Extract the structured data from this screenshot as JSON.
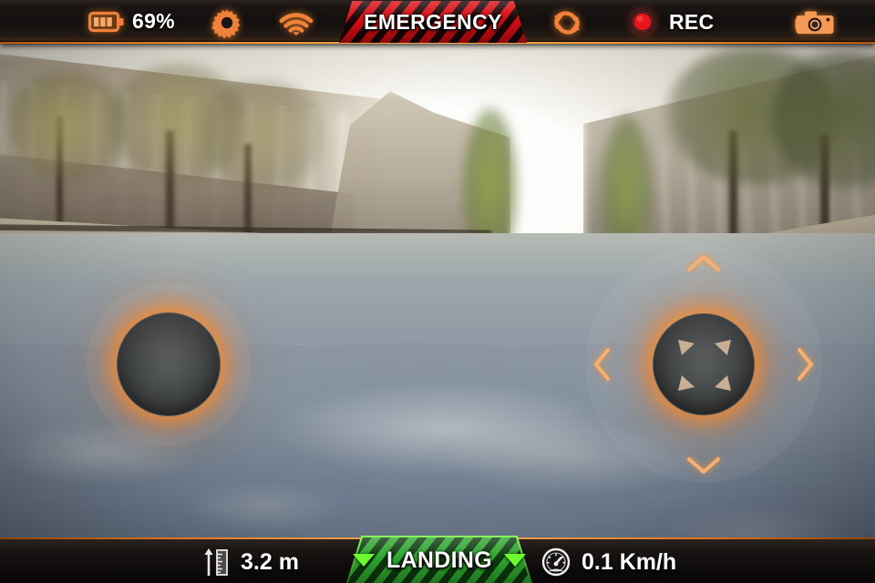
{
  "app": {
    "name": "drone-piloting-hud",
    "accent_color": "#e3741a",
    "emergency_color": "#d90d13",
    "landing_color": "#2ea62e"
  },
  "topbar": {
    "battery": {
      "icon": "battery-icon",
      "level_label": "69%",
      "bars": 3
    },
    "settings": {
      "icon": "gear-icon"
    },
    "wifi": {
      "icon": "wifi-icon",
      "bars": 3
    },
    "emergency": {
      "label": "EMERGENCY",
      "icon": "hazard-stripes"
    },
    "refresh": {
      "icon": "refresh-icon"
    },
    "record": {
      "icon": "record-dot-icon",
      "label": "REC",
      "dot_color": "#e8151b"
    },
    "photo": {
      "icon": "camera-icon"
    }
  },
  "bottombar": {
    "altitude": {
      "icon": "altitude-ruler-icon",
      "value": "3.2 m"
    },
    "landing": {
      "label": "LANDING",
      "icon": "triangle-down-icon"
    },
    "speed": {
      "icon": "speedometer-icon",
      "value": "0.1 Km/h"
    }
  },
  "controls": {
    "left_stick": {
      "name": "left-joystick",
      "label": ""
    },
    "right_stick": {
      "name": "right-joystick",
      "chevron_up": "chevron-up-icon",
      "chevron_down": "chevron-down-icon",
      "chevron_left": "chevron-left-icon",
      "chevron_right": "chevron-right-icon"
    }
  },
  "video": {
    "name": "live-camera-feed",
    "description": ""
  }
}
